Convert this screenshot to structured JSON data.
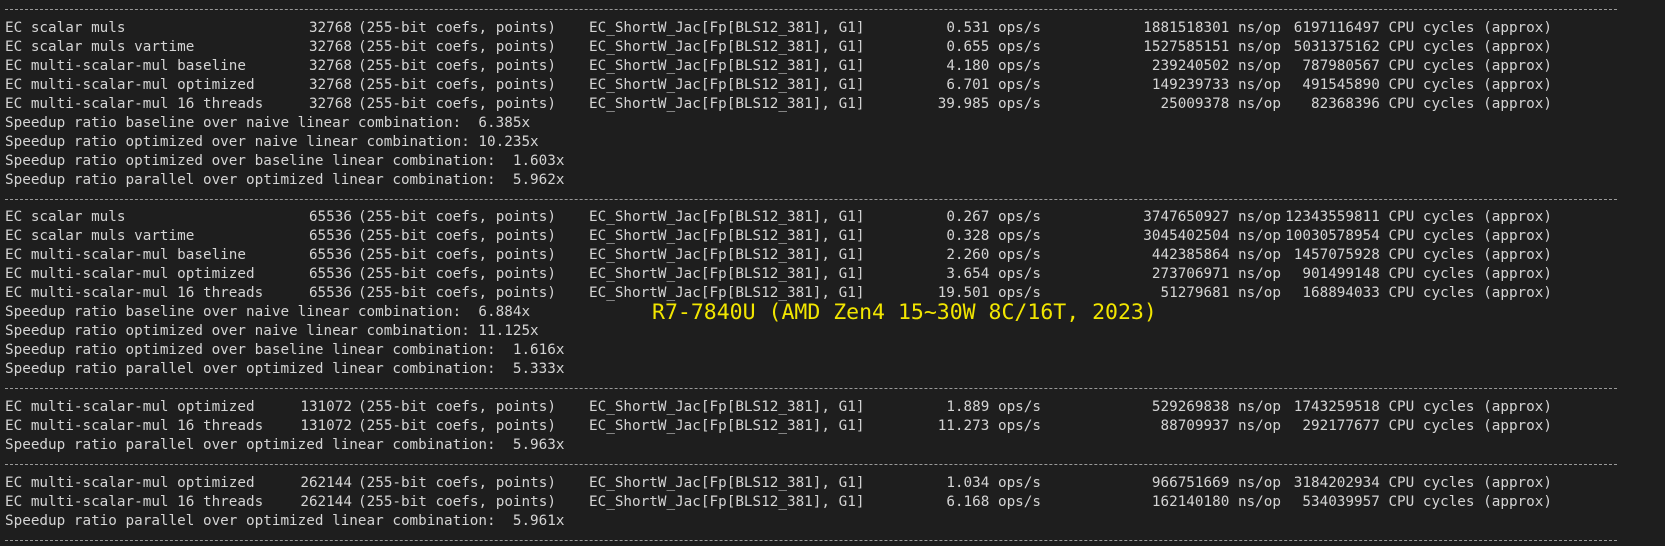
{
  "annotation": "R7-7840U (AMD Zen4 15~30W 8C/16T, 2023)",
  "blocks": [
    {
      "rows": [
        {
          "name": "EC scalar muls",
          "size": "32768",
          "desc": "(255-bit coefs, points)",
          "curve": "EC_ShortW_Jac[Fp[BLS12_381], G1]",
          "ops": "0.531 ops/s",
          "nsop": "1881518301 ns/op",
          "cycles": "6197116497 CPU cycles (approx)"
        },
        {
          "name": "EC scalar muls vartime",
          "size": "32768",
          "desc": "(255-bit coefs, points)",
          "curve": "EC_ShortW_Jac[Fp[BLS12_381], G1]",
          "ops": "0.655 ops/s",
          "nsop": "1527585151 ns/op",
          "cycles": "5031375162 CPU cycles (approx)"
        },
        {
          "name": "EC multi-scalar-mul baseline",
          "size": "32768",
          "desc": "(255-bit coefs, points)",
          "curve": "EC_ShortW_Jac[Fp[BLS12_381], G1]",
          "ops": "4.180 ops/s",
          "nsop": "239240502 ns/op",
          "cycles": "787980567 CPU cycles (approx)"
        },
        {
          "name": "EC multi-scalar-mul optimized",
          "size": "32768",
          "desc": "(255-bit coefs, points)",
          "curve": "EC_ShortW_Jac[Fp[BLS12_381], G1]",
          "ops": "6.701 ops/s",
          "nsop": "149239733 ns/op",
          "cycles": "491545890 CPU cycles (approx)"
        },
        {
          "name": "EC multi-scalar-mul 16 threads",
          "size": "32768",
          "desc": "(255-bit coefs, points)",
          "curve": "EC_ShortW_Jac[Fp[BLS12_381], G1]",
          "ops": "39.985 ops/s",
          "nsop": "25009378 ns/op",
          "cycles": "82368396 CPU cycles (approx)"
        }
      ],
      "ratios": [
        "Speedup ratio baseline over naive linear combination:  6.385x",
        "Speedup ratio optimized over naive linear combination: 10.235x",
        "Speedup ratio optimized over baseline linear combination:  1.603x",
        "Speedup ratio parallel over optimized linear combination:  5.962x"
      ]
    },
    {
      "rows": [
        {
          "name": "EC scalar muls",
          "size": "65536",
          "desc": "(255-bit coefs, points)",
          "curve": "EC_ShortW_Jac[Fp[BLS12_381], G1]",
          "ops": "0.267 ops/s",
          "nsop": "3747650927 ns/op",
          "cycles": "12343559811 CPU cycles (approx)"
        },
        {
          "name": "EC scalar muls vartime",
          "size": "65536",
          "desc": "(255-bit coefs, points)",
          "curve": "EC_ShortW_Jac[Fp[BLS12_381], G1]",
          "ops": "0.328 ops/s",
          "nsop": "3045402504 ns/op",
          "cycles": "10030578954 CPU cycles (approx)"
        },
        {
          "name": "EC multi-scalar-mul baseline",
          "size": "65536",
          "desc": "(255-bit coefs, points)",
          "curve": "EC_ShortW_Jac[Fp[BLS12_381], G1]",
          "ops": "2.260 ops/s",
          "nsop": "442385864 ns/op",
          "cycles": "1457075928 CPU cycles (approx)"
        },
        {
          "name": "EC multi-scalar-mul optimized",
          "size": "65536",
          "desc": "(255-bit coefs, points)",
          "curve": "EC_ShortW_Jac[Fp[BLS12_381], G1]",
          "ops": "3.654 ops/s",
          "nsop": "273706971 ns/op",
          "cycles": "901499148 CPU cycles (approx)"
        },
        {
          "name": "EC multi-scalar-mul 16 threads",
          "size": "65536",
          "desc": "(255-bit coefs, points)",
          "curve": "EC_ShortW_Jac[Fp[BLS12_381], G1]",
          "ops": "19.501 ops/s",
          "nsop": "51279681 ns/op",
          "cycles": "168894033 CPU cycles (approx)"
        }
      ],
      "ratios": [
        "Speedup ratio baseline over naive linear combination:  6.884x",
        "Speedup ratio optimized over naive linear combination: 11.125x",
        "Speedup ratio optimized over baseline linear combination:  1.616x",
        "Speedup ratio parallel over optimized linear combination:  5.333x"
      ]
    },
    {
      "rows": [
        {
          "name": "EC multi-scalar-mul optimized",
          "size": "131072",
          "desc": "(255-bit coefs, points)",
          "curve": "EC_ShortW_Jac[Fp[BLS12_381], G1]",
          "ops": "1.889 ops/s",
          "nsop": "529269838 ns/op",
          "cycles": "1743259518 CPU cycles (approx)"
        },
        {
          "name": "EC multi-scalar-mul 16 threads",
          "size": "131072",
          "desc": "(255-bit coefs, points)",
          "curve": "EC_ShortW_Jac[Fp[BLS12_381], G1]",
          "ops": "11.273 ops/s",
          "nsop": "88709937 ns/op",
          "cycles": "292177677 CPU cycles (approx)"
        }
      ],
      "ratios": [
        "Speedup ratio parallel over optimized linear combination:  5.963x"
      ]
    },
    {
      "rows": [
        {
          "name": "EC multi-scalar-mul optimized",
          "size": "262144",
          "desc": "(255-bit coefs, points)",
          "curve": "EC_ShortW_Jac[Fp[BLS12_381], G1]",
          "ops": "1.034 ops/s",
          "nsop": "966751669 ns/op",
          "cycles": "3184202934 CPU cycles (approx)"
        },
        {
          "name": "EC multi-scalar-mul 16 threads",
          "size": "262144",
          "desc": "(255-bit coefs, points)",
          "curve": "EC_ShortW_Jac[Fp[BLS12_381], G1]",
          "ops": "6.168 ops/s",
          "nsop": "162140180 ns/op",
          "cycles": "534039957 CPU cycles (approx)"
        }
      ],
      "ratios": [
        "Speedup ratio parallel over optimized linear combination:  5.961x"
      ]
    }
  ]
}
